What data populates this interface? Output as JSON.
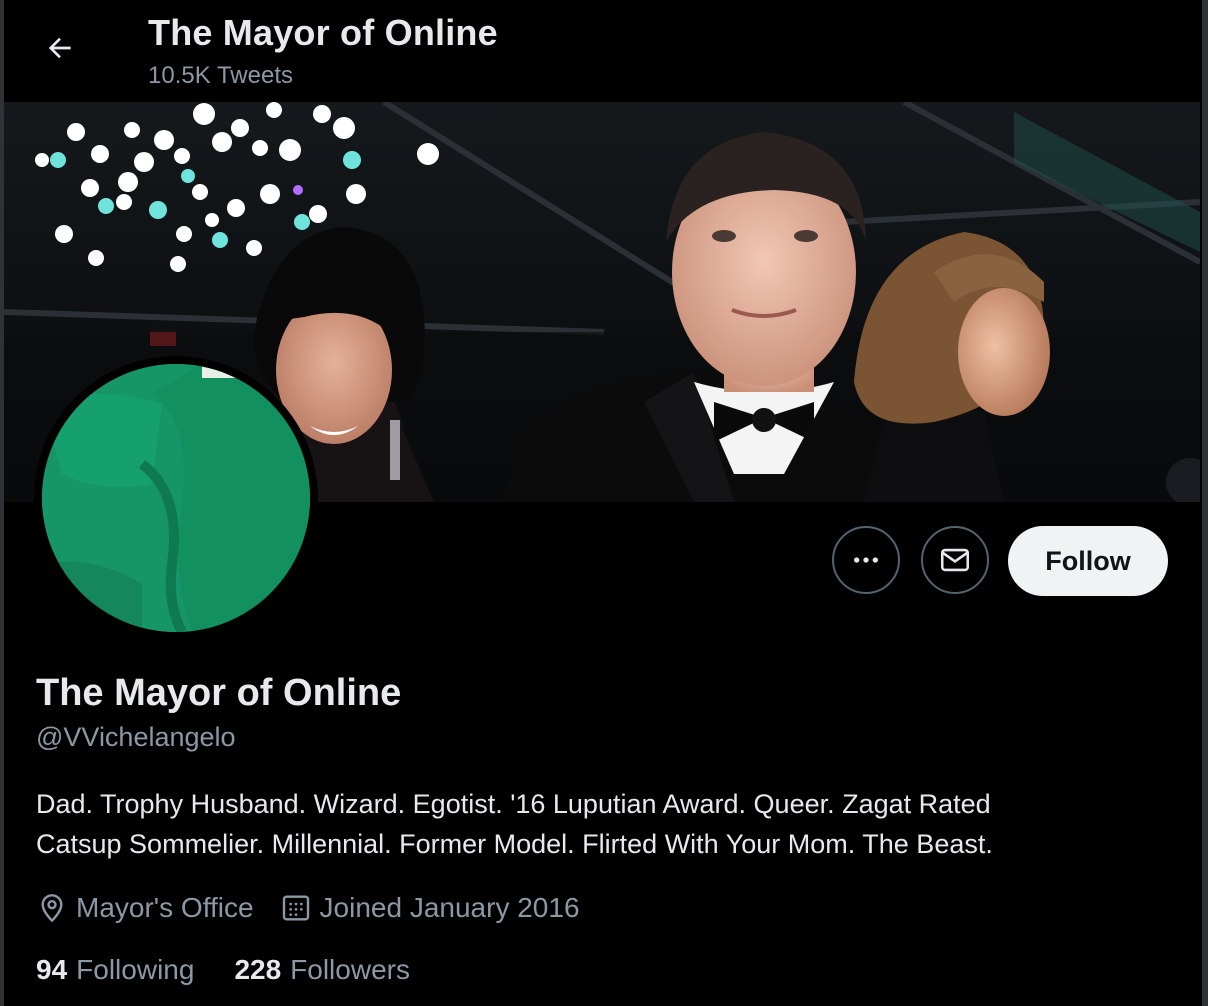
{
  "header": {
    "back_icon": "arrow-left-icon",
    "title": "The Mayor of Online",
    "tweet_count": "10.5K Tweets"
  },
  "actions": {
    "more_icon": "ellipsis-icon",
    "message_icon": "envelope-icon",
    "follow_label": "Follow"
  },
  "profile": {
    "display_name": "The Mayor of Online",
    "handle": "@VVichelangelo",
    "bio_lines": [
      "Dad. Trophy Husband. Wizard. Egotist. '16 Luputian Award. Queer. Zagat Rated",
      "Catsup Sommelier. Millennial. Former Model. Flirted With Your Mom. The Beast."
    ],
    "location_icon": "location-pin-icon",
    "location": "Mayor's Office",
    "joined_icon": "calendar-icon",
    "joined": "Joined January 2016"
  },
  "stats": {
    "following_count": "94",
    "following_label": "Following",
    "followers_count": "228",
    "followers_label": "Followers"
  },
  "colors": {
    "background": "#000000",
    "primary_text": "#e7e9ea",
    "secondary_text": "#8b98a5",
    "button_border": "#536471",
    "follow_bg": "#eff3f4",
    "avatar_green": "#169568"
  }
}
